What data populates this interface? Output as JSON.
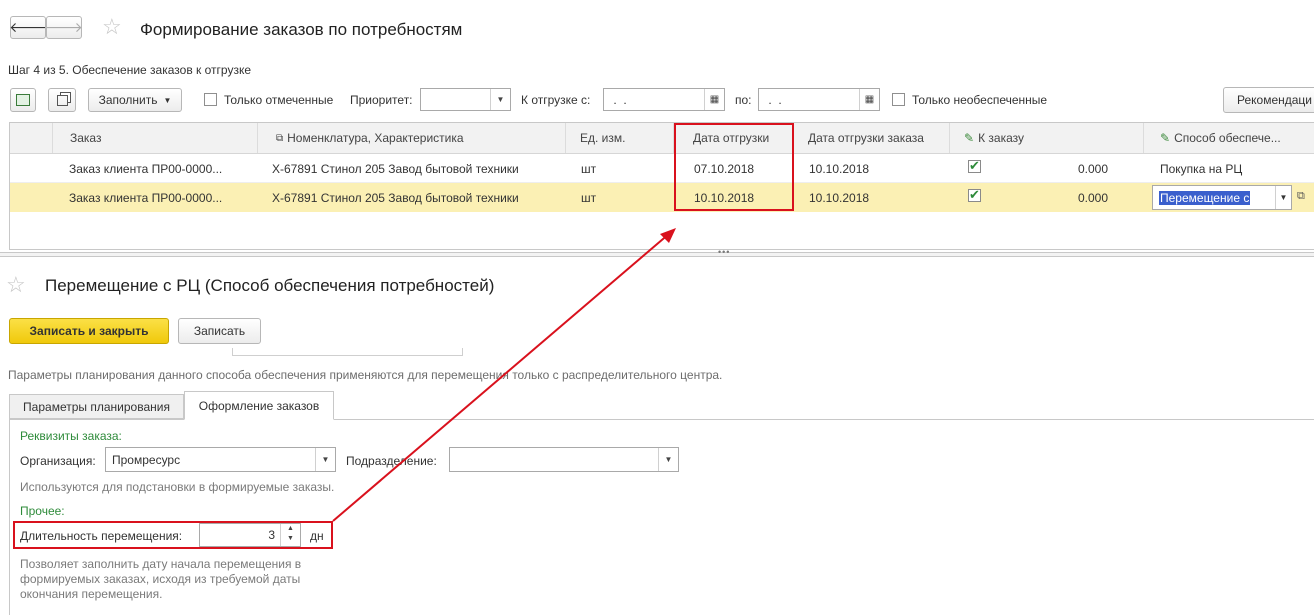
{
  "top": {
    "title": "Формирование заказов по потребностям",
    "step": "Шаг 4 из 5. Обеспечение заказов к отгрузке"
  },
  "toolbar": {
    "fill_label": "Заполнить",
    "only_marked": "Только отмеченные",
    "priority_label": "Приоритет:",
    "priority_value": "",
    "ship_from_label": "К отгрузке с:",
    "ship_from_value": " .  .",
    "to_label": "по:",
    "to_value": " .  .",
    "only_unprovided": "Только необеспеченные",
    "recommend_label": "Рекомендаци"
  },
  "table": {
    "columns": [
      "Заказ",
      "Номенклатура, Характеристика",
      "Ед. изм.",
      "Дата отгрузки",
      "Дата отгрузки заказа",
      "К заказу",
      "Способ обеспече..."
    ],
    "rows": [
      {
        "order": "Заказ клиента ПР00-0000...",
        "item": "Х-67891 Стинол 205 Завод бытовой техники",
        "unit": "шт",
        "ship_date": "07.10.2018",
        "order_ship_date": "10.10.2018",
        "to_order": "0.000",
        "method": "Покупка на РЦ",
        "checked": true
      },
      {
        "order": "Заказ клиента ПР00-0000...",
        "item": "Х-67891 Стинол 205 Завод бытовой техники",
        "unit": "шт",
        "ship_date": "10.10.2018",
        "order_ship_date": "10.10.2018",
        "to_order": "0.000",
        "method": "Перемещение с",
        "checked": true
      }
    ]
  },
  "form": {
    "title": "Перемещение с РЦ (Способ обеспечения потребностей)",
    "save_close_label": "Записать и закрыть",
    "save_label": "Записать",
    "description": "Параметры планирования данного способа обеспечения применяются для перемещения только с распределительного центра.",
    "tabs": [
      "Параметры планирования",
      "Оформление заказов"
    ],
    "requisites_label": "Реквизиты заказа:",
    "org_label": "Организация:",
    "org_value": "Промресурс",
    "division_label": "Подразделение:",
    "division_value": "",
    "used_hint": "Используются для подстановки в формируемые заказы.",
    "other_label": "Прочее:",
    "duration_label": "Длительность перемещения:",
    "duration_value": "3",
    "duration_unit": "дн",
    "duration_hint_1": "Позволяет заполнить дату начала перемещения в",
    "duration_hint_2": "формируемых заказах, исходя из требуемой даты",
    "duration_hint_3": "окончания перемещения."
  },
  "colors": {
    "highlight": "#d9111d",
    "selected_row": "#fbf0b4",
    "primary_button": "#f5d41b",
    "section_green": "#2e8b3a"
  }
}
